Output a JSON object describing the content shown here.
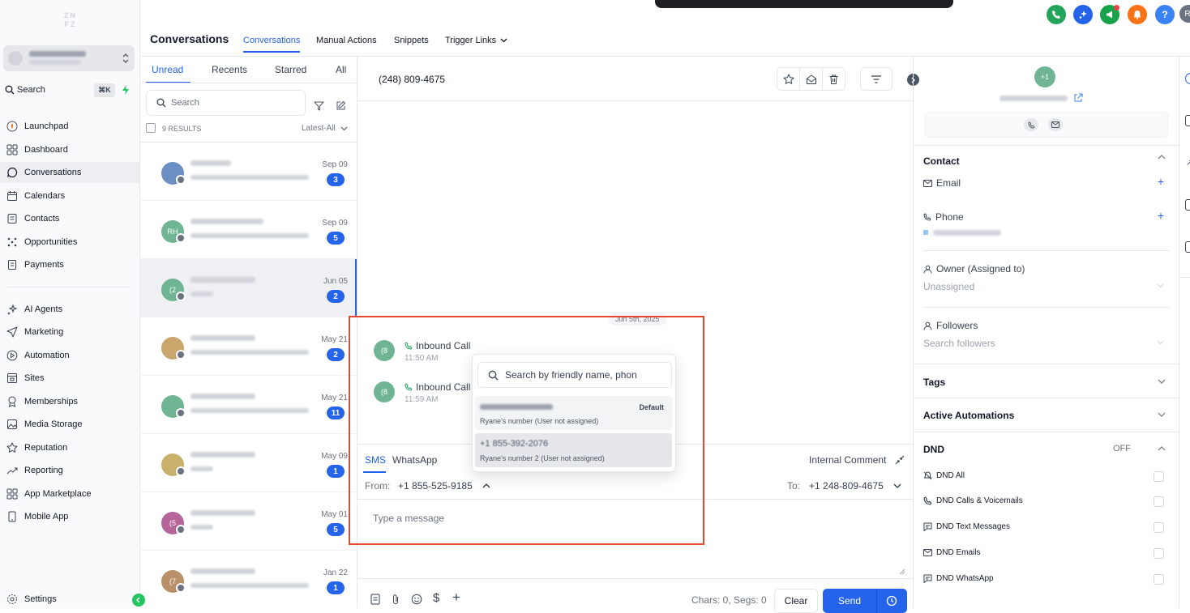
{
  "sidebar": {
    "search_label": "Search",
    "shortcut": "⌘K",
    "nav": [
      {
        "label": "Launchpad",
        "icon": "rocket-icon"
      },
      {
        "label": "Dashboard",
        "icon": "grid-icon"
      },
      {
        "label": "Conversations",
        "icon": "chat-icon"
      },
      {
        "label": "Calendars",
        "icon": "calendar-icon"
      },
      {
        "label": "Contacts",
        "icon": "contact-card-icon"
      },
      {
        "label": "Opportunities",
        "icon": "pipeline-icon"
      },
      {
        "label": "Payments",
        "icon": "receipt-icon"
      },
      {
        "label": "AI Agents",
        "icon": "sparkle-icon"
      },
      {
        "label": "Marketing",
        "icon": "send-icon"
      },
      {
        "label": "Automation",
        "icon": "play-circle-icon"
      },
      {
        "label": "Sites",
        "icon": "site-icon"
      },
      {
        "label": "Memberships",
        "icon": "award-icon"
      },
      {
        "label": "Media Storage",
        "icon": "image-icon"
      },
      {
        "label": "Reputation",
        "icon": "star-icon"
      },
      {
        "label": "Reporting",
        "icon": "trend-icon"
      },
      {
        "label": "App Marketplace",
        "icon": "apps-icon"
      },
      {
        "label": "Mobile App",
        "icon": "mobile-icon"
      }
    ],
    "settings_label": "Settings"
  },
  "header": {
    "title": "Conversations",
    "tabs": [
      "Conversations",
      "Manual Actions",
      "Snippets",
      "Trigger Links"
    ],
    "avatar_initial": "R",
    "colors": {
      "phone": "#22a55a",
      "sparkle": "#2563eb",
      "megaphone": "#16a34a",
      "bell": "#f97316",
      "help": "#3b82f6"
    }
  },
  "list": {
    "tabs": [
      "Unread",
      "Recents",
      "Starred",
      "All"
    ],
    "search_placeholder": "Search",
    "results": "9 RESULTS",
    "sort": "Latest-All",
    "rows": [
      {
        "date": "Sep 09",
        "badge": "3",
        "avatar": "",
        "color": "#6b8fc2"
      },
      {
        "date": "Sep 09",
        "badge": "5",
        "avatar": "RH",
        "color": "#6fb593"
      },
      {
        "date": "Jun 05",
        "badge": "2",
        "avatar": "(2",
        "color": "#6fb593"
      },
      {
        "date": "May 21",
        "badge": "2",
        "avatar": "",
        "color": "#c9a66b"
      },
      {
        "date": "May 21",
        "badge": "11",
        "avatar": "",
        "color": "#6fb593"
      },
      {
        "date": "May 09",
        "badge": "1",
        "avatar": "",
        "color": "#c9b16b"
      },
      {
        "date": "May 01",
        "badge": "5",
        "avatar": "(5",
        "color": "#b5659a"
      },
      {
        "date": "Jan 22",
        "badge": "1",
        "avatar": "(7",
        "color": "#b99068"
      }
    ]
  },
  "chat": {
    "phone": "(248) 809-4675",
    "date_chip": "Jun 5th, 2025",
    "messages": [
      {
        "avatar": "(8",
        "text": "Inbound Call",
        "time": "11:50 AM"
      },
      {
        "avatar": "(8",
        "text": "Inbound Call",
        "time": "11:59 AM"
      }
    ],
    "composer": {
      "tabs": [
        "SMS",
        "WhatsApp"
      ],
      "internal_comment": "Internal Comment",
      "from_label": "From:",
      "from_number": "+1 855-525-9185",
      "to_label": "To:",
      "to_number": "+1 248-809-4675",
      "placeholder": "Type a message",
      "chars": "Chars: 0, Segs: 0",
      "clear": "Clear",
      "send": "Send"
    },
    "dropdown": {
      "placeholder": "Search by friendly name, phon",
      "options": [
        {
          "number": "",
          "sub": "Ryane's number (User not assigned)",
          "tag": "Default"
        },
        {
          "number": "+1 855-392-2076",
          "sub": "Ryane's number 2 (User not assigned)",
          "tag": ""
        }
      ]
    }
  },
  "contact": {
    "avatar": "+1",
    "sections": {
      "contact": "Contact",
      "email": "Email",
      "phone": "Phone",
      "owner": "Owner (Assigned to)",
      "owner_value": "Unassigned",
      "followers": "Followers",
      "followers_placeholder": "Search followers",
      "tags": "Tags",
      "active_automations": "Active Automations",
      "dnd": "DND",
      "dnd_state": "OFF"
    },
    "dnd_items": [
      "DND All",
      "DND Calls & Voicemails",
      "DND Text Messages",
      "DND Emails",
      "DND WhatsApp"
    ]
  }
}
